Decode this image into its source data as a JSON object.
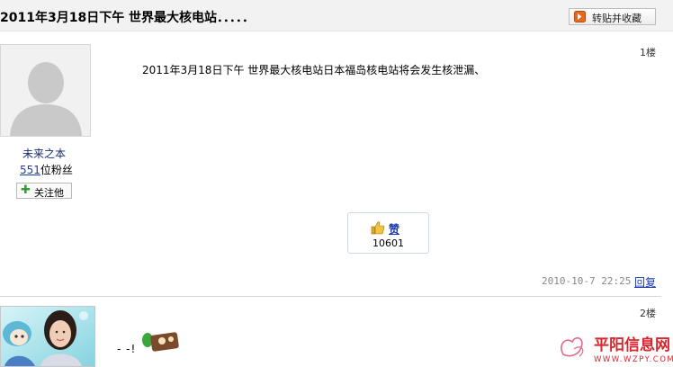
{
  "thread": {
    "title": "2011年3月18日下午  世界最大核电站．．．．．",
    "repost_label": "转贴并收藏"
  },
  "post1": {
    "floor": "1楼",
    "author": "未来之本",
    "fans_count": "551",
    "fans_suffix": "位粉丝",
    "follow_label": "关注他",
    "body": "2011年3月18日下午  世界最大核电站日本福岛核电站将会发生核泄漏、",
    "like_label": "赞",
    "like_count": "10601",
    "timestamp": "2010-10-7  22:25",
    "reply_label": "回复"
  },
  "post2": {
    "floor": "2楼",
    "body": "- -!"
  },
  "watermark": {
    "site_name": "平阳信息网",
    "url": "WWW.WZPY.COM"
  },
  "colors": {
    "link": "#1a3ab0",
    "header_bg": "#f2f2f2",
    "follow_plus": "#2e9e2e",
    "watermark_red": "#d9262e"
  }
}
